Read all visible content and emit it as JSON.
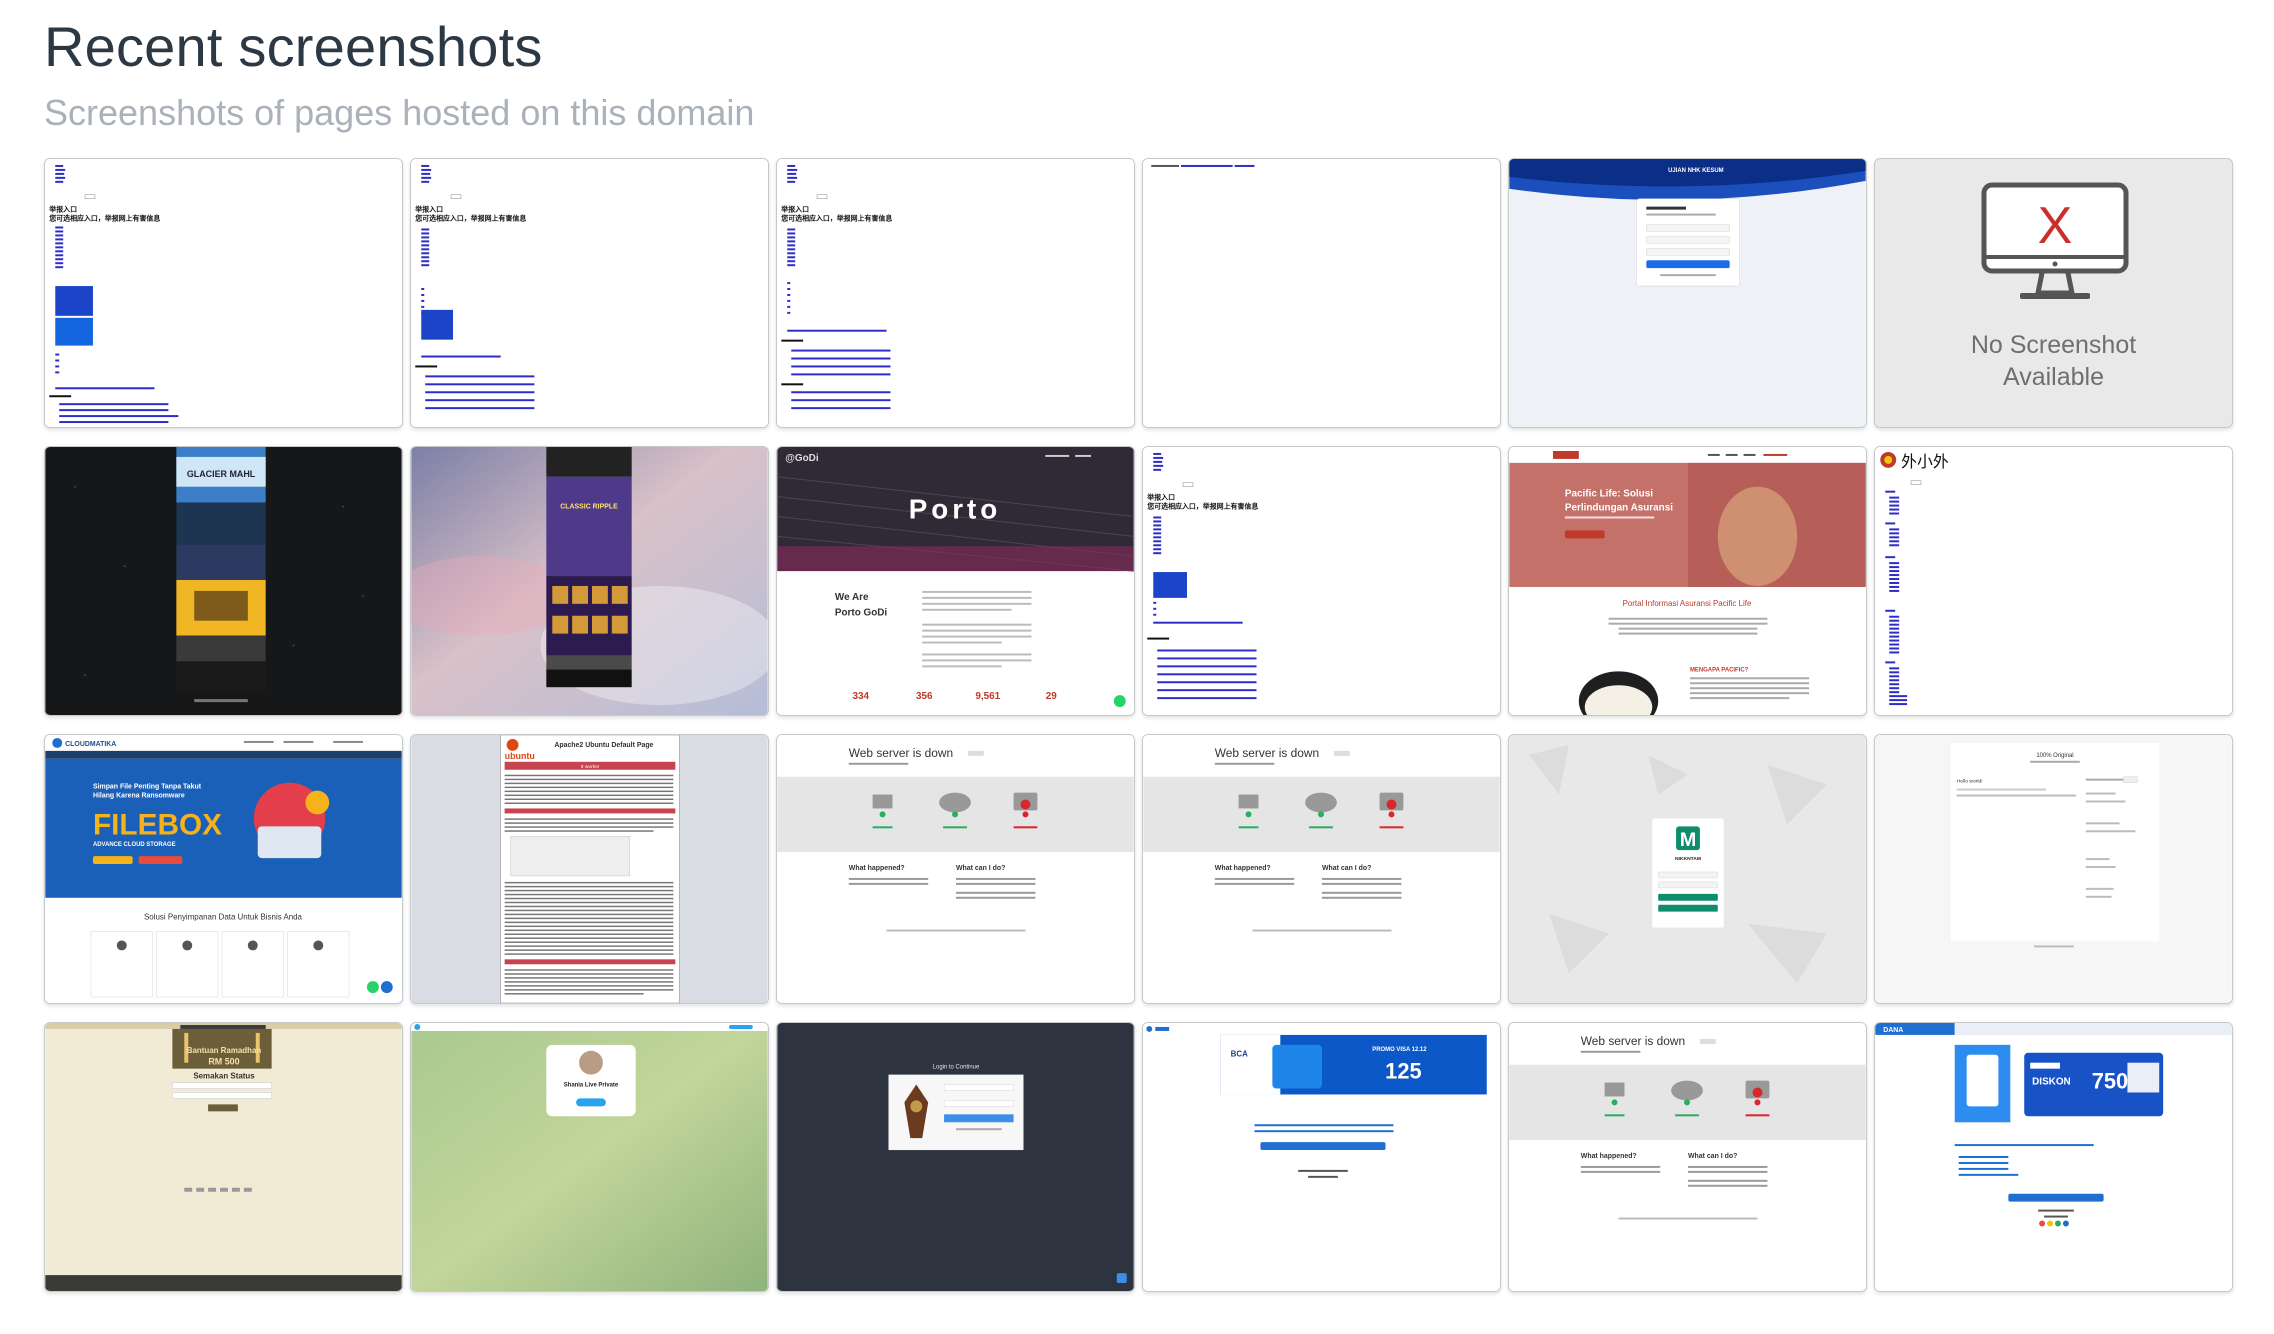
{
  "header": {
    "title": "Recent screenshots",
    "subtitle": "Screenshots of pages hosted on this domain"
  },
  "colors": {
    "title": "#2c3844",
    "subtitle": "#aab1b8",
    "card_border": "#c6c9cc",
    "placeholder_bg": "#e9e9e9",
    "placeholder_x": "#c9302c"
  },
  "screenshots": [
    {
      "kind": "chinese-portal",
      "heading1": "举报入口",
      "heading2": "您可选相应入口，举报网上有害信息"
    },
    {
      "kind": "chinese-portal",
      "heading1": "举报入口",
      "heading2": "您可选相应入口，举报网上有害信息"
    },
    {
      "kind": "chinese-portal",
      "heading1": "举报入口",
      "heading2": "您可选相应入口，举报网上有害信息"
    },
    {
      "kind": "blank-links"
    },
    {
      "kind": "login-form",
      "title": "UJIAN NHK KESUM"
    },
    {
      "kind": "no-screenshot",
      "line1": "No Screenshot",
      "line2": "Available",
      "glyph": "X",
      "icon": "monitor-icon"
    },
    {
      "kind": "dark-game-banner",
      "text": "GLACIER MAHL"
    },
    {
      "kind": "blurred-game-banner",
      "text": "CLASSIC RIPPLE"
    },
    {
      "kind": "porto-site",
      "brand": "@GoDi",
      "headline": "Porto",
      "about": "We Are",
      "about2": "Porto GoDi",
      "stats": [
        "334",
        "356",
        "9,561",
        "29"
      ]
    },
    {
      "kind": "chinese-portal",
      "heading1": "举报入口",
      "heading2": "您可选相应入口，举报网上有害信息"
    },
    {
      "kind": "insurance-site",
      "hero1": "Pacific Life: Solusi",
      "hero2": "Perlindungan Asuransi",
      "section": "Portal Informasi Asuransi Pacific Life",
      "section2": "MENGAPA PACIFIC?"
    },
    {
      "kind": "chinese-tree",
      "logo_text": "外小外"
    },
    {
      "kind": "cloud-storage",
      "brand": "CLOUDMATIKA",
      "hero1": "Simpan File Penting Tanpa Takut",
      "hero2": "Hilang Karena Ransomware",
      "product": "FILEBOX",
      "tagline": "ADVANCE CLOUD STORAGE",
      "section": "Solusi Penyimpanan Data Untuk Bisnis Anda"
    },
    {
      "kind": "apache-default",
      "title": "Apache2 Ubuntu Default Page",
      "logo": "ubuntu",
      "banner": "It works!"
    },
    {
      "kind": "server-down",
      "title": "Web server is down",
      "q1": "What happened?",
      "q2": "What can I do?"
    },
    {
      "kind": "server-down",
      "title": "Web server is down",
      "q1": "What happened?",
      "q2": "What can I do?"
    },
    {
      "kind": "app-login",
      "logo_letter": "M",
      "app_name": "NIKKNTAM"
    },
    {
      "kind": "blog",
      "header": "100% Original",
      "post": "Hello world!"
    },
    {
      "kind": "ramadan-form",
      "title": "Bantuan Ramadhan",
      "amount": "RM 500",
      "subtitle": "Semakan Status"
    },
    {
      "kind": "telegram",
      "name": "Shania Live Private"
    },
    {
      "kind": "dark-login",
      "title": "Login to Continue"
    },
    {
      "kind": "bank-promo",
      "promo": "PROMO VISA 12.12",
      "amount": "125"
    },
    {
      "kind": "server-down",
      "title": "Web server is down",
      "q1": "What happened?",
      "q2": "What can I do?"
    },
    {
      "kind": "dana-promo",
      "brand": "DANA",
      "label": "DISKON",
      "amount": "750"
    }
  ]
}
